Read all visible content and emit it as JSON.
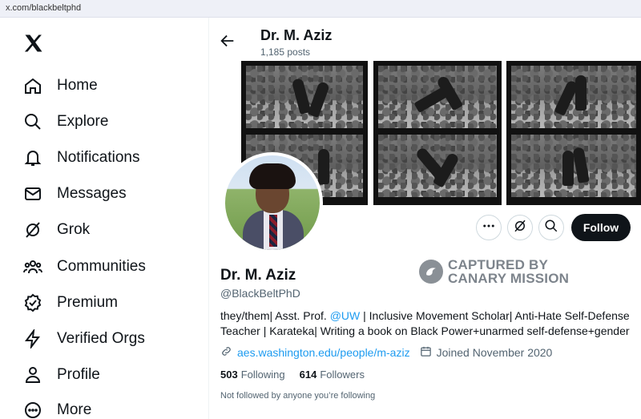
{
  "browser": {
    "url": "x.com/blackbeltphd"
  },
  "sidebar": {
    "logo_icon": "x-logo",
    "items": [
      {
        "label": "Home",
        "icon": "home-icon"
      },
      {
        "label": "Explore",
        "icon": "search-icon"
      },
      {
        "label": "Notifications",
        "icon": "bell-icon"
      },
      {
        "label": "Messages",
        "icon": "envelope-icon"
      },
      {
        "label": "Grok",
        "icon": "grok-icon"
      },
      {
        "label": "Communities",
        "icon": "people-icon"
      },
      {
        "label": "Premium",
        "icon": "verified-badge-icon"
      },
      {
        "label": "Verified Orgs",
        "icon": "lightning-icon"
      },
      {
        "label": "Profile",
        "icon": "person-icon"
      },
      {
        "label": "More",
        "icon": "more-circle-icon"
      }
    ]
  },
  "header": {
    "name": "Dr. M. Aziz",
    "posts": "1,185 posts"
  },
  "actions": {
    "follow_label": "Follow"
  },
  "watermark": {
    "line1": "CAPTURED BY",
    "line2": "CANARY MISSION"
  },
  "profile": {
    "name": "Dr. M. Aziz",
    "handle": "@BlackBeltPhD",
    "bio_pre": "they/them| Asst. Prof. ",
    "bio_mention": "@UW",
    "bio_post": " | Inclusive Movement Scholar| Anti-Hate Self-Defense Teacher | Karateka| Writing a book on Black Power+unarmed self-defense+gender",
    "website": "aes.washington.edu/people/m-aziz",
    "joined": "Joined November 2020",
    "following_count": "503",
    "following_label": "Following",
    "followers_count": "614",
    "followers_label": "Followers",
    "mutual_note": "Not followed by anyone you’re following"
  },
  "colors": {
    "accent": "#1d9bf0",
    "text": "#0f1419",
    "muted": "#536471",
    "follow_bg": "#0f1419"
  }
}
